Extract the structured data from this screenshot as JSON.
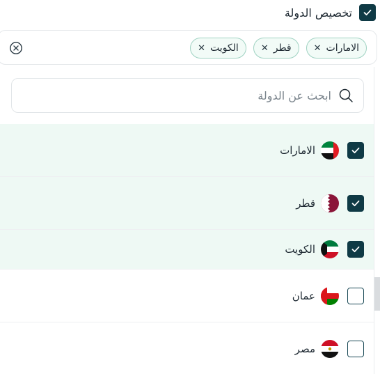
{
  "header": {
    "title": "تخصيص الدولة",
    "checked": true
  },
  "selected_chips": [
    {
      "label": "الامارات"
    },
    {
      "label": "قطر"
    },
    {
      "label": "الكويت"
    }
  ],
  "search": {
    "placeholder": "ابحث عن الدولة"
  },
  "countries": [
    {
      "label": "الامارات",
      "checked": true,
      "flag": "uae-flag"
    },
    {
      "label": "قطر",
      "checked": true,
      "flag": "qatar-flag"
    },
    {
      "label": "الكويت",
      "checked": true,
      "flag": "kuwait-flag"
    },
    {
      "label": "عمان",
      "checked": false,
      "flag": "oman-flag"
    },
    {
      "label": "مصر",
      "checked": false,
      "flag": "egypt-flag"
    }
  ],
  "colors": {
    "accent": "#0f3a45",
    "chip_border": "#9fd2c2",
    "selected_row": "#eef9f4"
  }
}
